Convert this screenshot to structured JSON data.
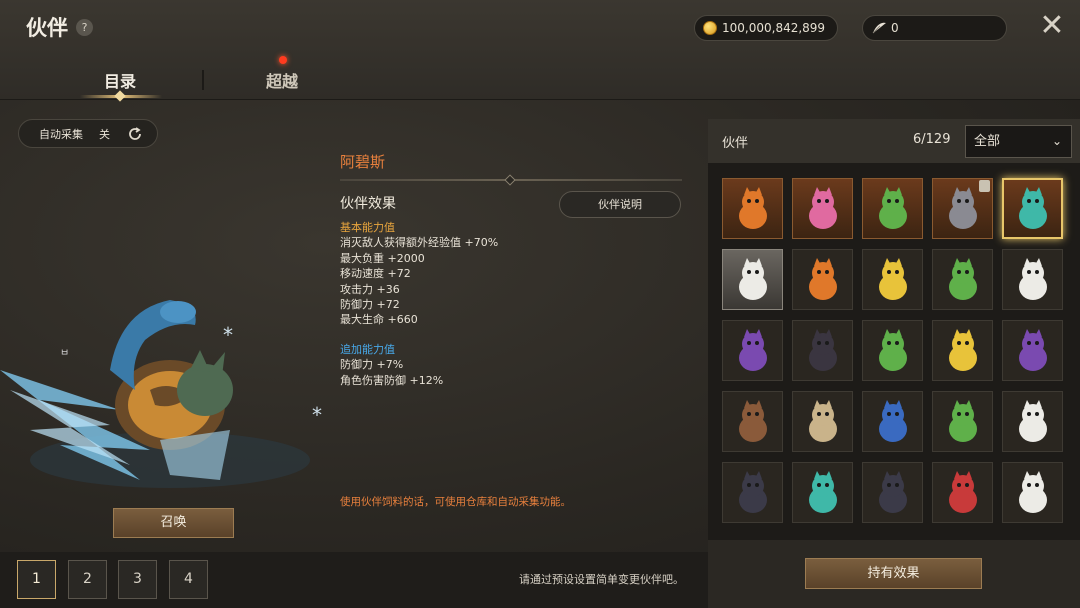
{
  "header": {
    "title": "伙伴",
    "help": "?",
    "gold": "100,000,842,899",
    "feathers": "0",
    "close": "✕"
  },
  "tabs": [
    {
      "label": "目录",
      "active": true
    },
    {
      "label": "超越",
      "has_alert": true
    }
  ],
  "auto_collect": {
    "label": "自动采集",
    "state": "关"
  },
  "summon_label": "召唤",
  "pet": {
    "name": "阿碧斯",
    "effect_title": "伙伴效果",
    "explain_button": "伙伴说明",
    "base_title": "基本能力值",
    "base_stats": [
      "消灭敌人获得额外经验值 +70%",
      "最大负重 +2000",
      "移动速度 +72",
      "攻击力 +36",
      "防御力 +72",
      "最大生命 +660"
    ],
    "extra_title": "追加能力值",
    "extra_stats": [
      "防御力 +7%",
      "角色伤害防御 +12%"
    ],
    "note": "使用伙伴饲料的话，可使用仓库和自动采集功能。"
  },
  "presets": [
    "1",
    "2",
    "3",
    "4"
  ],
  "preset_hint": "请通过预设设置简单变更伙伴吧。",
  "panel": {
    "title": "伙伴",
    "count": "6/129",
    "filter": "全部"
  },
  "hold_effect_label": "持有效果",
  "colors": {
    "accent_orange": "#e8803d",
    "base_stat_gold": "#e8a53d",
    "extra_stat_blue": "#48a8e8",
    "selected_frame": "#e8c66a"
  },
  "grid_icons": [
    "orange-lion-icon",
    "pink-dragon-icon",
    "green-frog-icon",
    "gray-wolf-icon",
    "teal-dragon-icon",
    "white-chick-icon",
    "orange-bird-icon",
    "yellow-bug-icon",
    "green-sprout-icon",
    "white-tiger-icon",
    "purple-cat-icon",
    "black-dragon-icon",
    "green-dragon-icon",
    "yellow-chick-icon",
    "purple-witch-icon",
    "brown-bird-icon",
    "beige-bag-icon",
    "blue-dragon-icon",
    "green-girl-icon",
    "white-dog-icon",
    "dark-wolf-icon",
    "teal-dino-icon",
    "dark-bird-icon",
    "red-dragon-icon",
    "white-cat-icon"
  ]
}
